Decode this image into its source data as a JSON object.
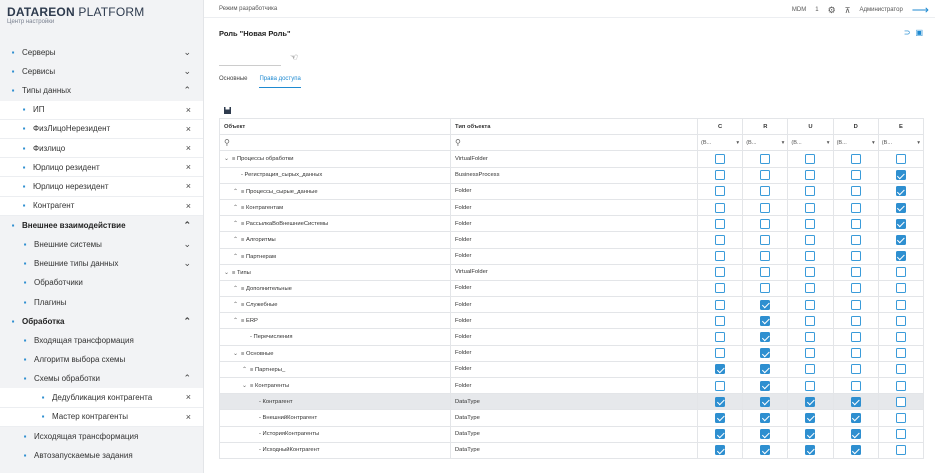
{
  "brand": {
    "name_bold": "DATAREON",
    "name_rest": " PLATFORM",
    "subtitle": "Центр настройки"
  },
  "colors": {
    "accent": "#1f8ad1",
    "checkbox_on": "#2e8fd0",
    "sidebar_bg": "#f2f3f5"
  },
  "sidebar": {
    "items": [
      {
        "label": "Серверы",
        "icon": "server-icon",
        "trail": "⌄",
        "type": "top"
      },
      {
        "label": "Сервисы",
        "icon": "monitor-icon",
        "trail": "⌄",
        "type": "top"
      },
      {
        "label": "Типы данных",
        "icon": "hierarchy-icon",
        "trail": "⌃",
        "type": "top"
      },
      {
        "label": "ИП",
        "icon": "hierarchy-icon",
        "trail": "×",
        "type": "sub"
      },
      {
        "label": "ФизЛицоНерезидент",
        "icon": "hierarchy-icon",
        "trail": "×",
        "type": "sub"
      },
      {
        "label": "Физлицо",
        "icon": "hierarchy-icon",
        "trail": "×",
        "type": "sub"
      },
      {
        "label": "Юрлицо резидент",
        "icon": "hierarchy-icon",
        "trail": "×",
        "type": "sub"
      },
      {
        "label": "Юрлицо нерезидент",
        "icon": "hierarchy-icon",
        "trail": "×",
        "type": "sub"
      },
      {
        "label": "Контрагент",
        "icon": "hierarchy-icon",
        "trail": "×",
        "type": "sub"
      },
      {
        "label": "Внешнее взаимодействие",
        "icon": "globe-icon",
        "trail": "⌃",
        "type": "bold"
      },
      {
        "label": "Внешние системы",
        "icon": "link-icon",
        "trail": "⌄",
        "type": "top2"
      },
      {
        "label": "Внешние типы данных",
        "icon": "link-icon",
        "trail": "⌄",
        "type": "top2"
      },
      {
        "label": "Обработчики",
        "icon": "window-icon",
        "trail": "",
        "type": "top2"
      },
      {
        "label": "Плагины",
        "icon": "puzzle-icon",
        "trail": "",
        "type": "top2"
      },
      {
        "label": "Обработка",
        "icon": "flow-icon",
        "trail": "⌃",
        "type": "bold"
      },
      {
        "label": "Входящая трансформация",
        "icon": "upload-icon",
        "trail": "",
        "type": "top2"
      },
      {
        "label": "Алгоритм выбора схемы",
        "icon": "grid-icon",
        "trail": "",
        "type": "top2"
      },
      {
        "label": "Схемы обработки",
        "icon": "schema-icon",
        "trail": "⌃",
        "type": "top2"
      },
      {
        "label": "Дедубликация контрагента",
        "icon": "schema-icon",
        "trail": "×",
        "type": "sub2"
      },
      {
        "label": "Мастер контрагенты",
        "icon": "schema-icon",
        "trail": "×",
        "type": "sub2"
      },
      {
        "label": "Исходящая трансформация",
        "icon": "download-icon",
        "trail": "",
        "type": "top2"
      },
      {
        "label": "Автозапускаемые задания",
        "icon": "calendar-icon",
        "trail": "",
        "type": "top2"
      }
    ]
  },
  "topbar": {
    "mode": "Режим разработчика",
    "mdm": "MDM",
    "count": "1",
    "user": "Администратор"
  },
  "page": {
    "title": "Роль \"Новая Роль\""
  },
  "tabs": [
    {
      "label": "Основные"
    },
    {
      "label": "Права доступа"
    }
  ],
  "table": {
    "headers": [
      "Объект",
      "Тип объекта",
      "C",
      "R",
      "U",
      "D",
      "E"
    ],
    "filter": "(В...",
    "rows": [
      {
        "indent": 0,
        "tw": "⌄",
        "obj": "≡ Процессы обработки",
        "type": "VirtualFolder",
        "p": [
          0,
          0,
          0,
          0,
          0
        ]
      },
      {
        "indent": 1,
        "tw": "",
        "obj": "‐ Регистрация_сырых_данных",
        "type": "BusinessProcess",
        "p": [
          0,
          0,
          0,
          0,
          1
        ]
      },
      {
        "indent": 1,
        "tw": "⌃",
        "obj": "≡ Процессы_сырые_данные",
        "type": "Folder",
        "p": [
          0,
          0,
          0,
          0,
          1
        ]
      },
      {
        "indent": 1,
        "tw": "⌃",
        "obj": "≡ Контрагентам",
        "type": "Folder",
        "p": [
          0,
          0,
          0,
          0,
          1
        ]
      },
      {
        "indent": 1,
        "tw": "⌃",
        "obj": "≡ РассылкаВоВнешниеСистемы",
        "type": "Folder",
        "p": [
          0,
          0,
          0,
          0,
          1
        ]
      },
      {
        "indent": 1,
        "tw": "⌃",
        "obj": "≡ Алгоритмы",
        "type": "Folder",
        "p": [
          0,
          0,
          0,
          0,
          1
        ]
      },
      {
        "indent": 1,
        "tw": "⌃",
        "obj": "≡ Партнерам",
        "type": "Folder",
        "p": [
          0,
          0,
          0,
          0,
          1
        ]
      },
      {
        "indent": 0,
        "tw": "⌄",
        "obj": "≡ Типы",
        "type": "VirtualFolder",
        "p": [
          0,
          0,
          0,
          0,
          0
        ]
      },
      {
        "indent": 1,
        "tw": "⌃",
        "obj": "≡ Дополнительные",
        "type": "Folder",
        "p": [
          0,
          0,
          0,
          0,
          0
        ]
      },
      {
        "indent": 1,
        "tw": "⌃",
        "obj": "≡ Служебные",
        "type": "Folder",
        "p": [
          0,
          1,
          0,
          0,
          0
        ]
      },
      {
        "indent": 1,
        "tw": "⌃",
        "obj": "≡ ERP",
        "type": "Folder",
        "p": [
          0,
          1,
          0,
          0,
          0
        ]
      },
      {
        "indent": 2,
        "tw": "",
        "obj": "‐ Перечисления",
        "type": "Folder",
        "p": [
          0,
          1,
          0,
          0,
          0
        ]
      },
      {
        "indent": 1,
        "tw": "⌄",
        "obj": "≡ Основные",
        "type": "Folder",
        "p": [
          0,
          1,
          0,
          0,
          0
        ]
      },
      {
        "indent": 2,
        "tw": "⌃",
        "obj": "≡ Партнеры_",
        "type": "Folder",
        "p": [
          1,
          1,
          0,
          0,
          0
        ]
      },
      {
        "indent": 2,
        "tw": "⌄",
        "obj": "≡ Контрагенты",
        "type": "Folder",
        "p": [
          0,
          1,
          0,
          0,
          0
        ]
      },
      {
        "indent": 3,
        "tw": "",
        "obj": "‐ Контрагент",
        "type": "DataType",
        "p": [
          1,
          1,
          1,
          1,
          0
        ],
        "hl": true
      },
      {
        "indent": 3,
        "tw": "",
        "obj": "‐ ВнешнийКонтрагент",
        "type": "DataType",
        "p": [
          1,
          1,
          1,
          1,
          0
        ]
      },
      {
        "indent": 3,
        "tw": "",
        "obj": "‐ ИсторияКонтрагенты",
        "type": "DataType",
        "p": [
          1,
          1,
          1,
          1,
          0
        ]
      },
      {
        "indent": 3,
        "tw": "",
        "obj": "‐ ИсходныйКонтрагент",
        "type": "DataType",
        "p": [
          1,
          1,
          1,
          1,
          0
        ]
      }
    ]
  }
}
